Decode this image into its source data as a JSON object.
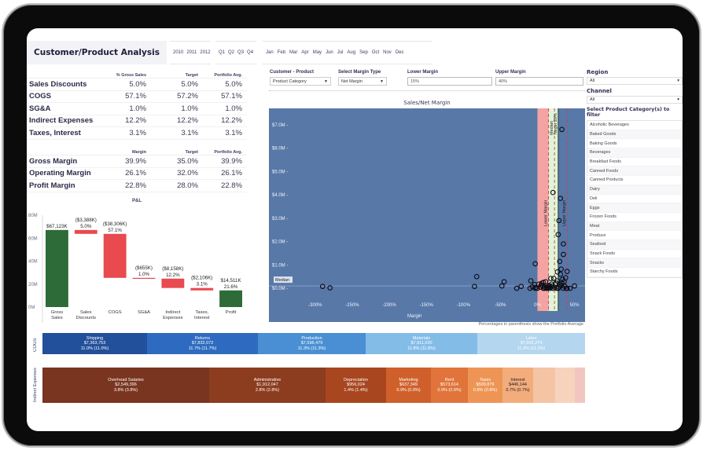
{
  "header": {
    "title": "Customer/Product Analysis",
    "years": [
      "2010",
      "2011",
      "2012"
    ],
    "quarters": [
      "Q1",
      "Q2",
      "Q3",
      "Q4"
    ],
    "months": [
      "Jan",
      "Feb",
      "Mar",
      "Apr",
      "May",
      "Jun",
      "Jul",
      "Aug",
      "Sep",
      "Oct",
      "Nov",
      "Dec"
    ]
  },
  "expenses_table": {
    "headers": [
      "% Gross Sales",
      "Target",
      "Portfolio Avg."
    ],
    "rows": [
      {
        "label": "Sales Discounts",
        "values": [
          "5.0%",
          "5.0%",
          "5.0%"
        ]
      },
      {
        "label": "COGS",
        "values": [
          "57.1%",
          "57.2%",
          "57.1%"
        ]
      },
      {
        "label": "SG&A",
        "values": [
          "1.0%",
          "1.0%",
          "1.0%"
        ]
      },
      {
        "label": "Indirect Expenses",
        "values": [
          "12.2%",
          "12.2%",
          "12.2%"
        ]
      },
      {
        "label": "Taxes, Interest",
        "values": [
          "3.1%",
          "3.1%",
          "3.1%"
        ]
      }
    ]
  },
  "margin_table": {
    "headers": [
      "Margin",
      "Target",
      "Portfolio Avg."
    ],
    "rows": [
      {
        "label": "Gross Margin",
        "values": [
          "39.9%",
          "35.0%",
          "39.9%"
        ]
      },
      {
        "label": "Operating Margin",
        "values": [
          "26.1%",
          "32.0%",
          "26.1%"
        ]
      },
      {
        "label": "Profit Margin",
        "values": [
          "22.8%",
          "28.0%",
          "22.8%"
        ]
      }
    ]
  },
  "controls": {
    "customer_product_label": "Customer - Product",
    "customer_product_value": "Product Category",
    "margin_type_label": "Select Margin Type",
    "margin_type_value": "Net Margin",
    "lower_margin_label": "Lower Margin",
    "lower_margin_value": "15%",
    "upper_margin_label": "Upper Margin",
    "upper_margin_value": "40%"
  },
  "right_panel": {
    "region_label": "Region",
    "region_value": "All",
    "channel_label": "Channel",
    "channel_value": "All",
    "category_label": "Select Product Category(s) to filter",
    "categories": [
      "Alcoholic Beverages",
      "Baked Goods",
      "Baking Goods",
      "Beverages",
      "Breakfast Foods",
      "Canned Foods",
      "Canned Products",
      "Dairy",
      "Deli",
      "Eggs",
      "Frozen Foods",
      "Meat",
      "Produce",
      "Seafood",
      "Snack Foods",
      "Snacks",
      "Starchy Foods"
    ]
  },
  "cogs_treemap": {
    "side_label": "COGS",
    "cells": [
      {
        "name": "Shipping",
        "amount": "$7,363,753",
        "pct": "11.0% (11.0%)",
        "color": "#22509a"
      },
      {
        "name": "Returns",
        "amount": "$7,832,072",
        "pct": "11.7% (11.7%)",
        "color": "#2e6bc0"
      },
      {
        "name": "Production",
        "amount": "$7,596,479",
        "pct": "11.3% (11.3%)",
        "color": "#4a8fd3"
      },
      {
        "name": "Materials",
        "amount": "$7,911,020",
        "pct": "11.8% (11.8%)",
        "color": "#84bce8"
      },
      {
        "name": "Labor",
        "amount": "$7,602,274",
        "pct": "11.3% (11.3%)",
        "color": "#b4d6ef"
      }
    ]
  },
  "indirect_treemap": {
    "side_label": "Indirect Expenses",
    "cells": [
      {
        "name": "Overhead Salaries",
        "amount": "$2,549,396",
        "pct": "3.8% (3.8%)",
        "color": "#7a3520"
      },
      {
        "name": "Administrative",
        "amount": "$1,912,047",
        "pct": "2.8% (2.8%)",
        "color": "#8c3c1f"
      },
      {
        "name": "Depreciation",
        "amount": "$956,024",
        "pct": "1.4% (1.4%)",
        "color": "#a8461f"
      },
      {
        "name": "Marketing",
        "amount": "$637,349",
        "pct": "0.9% (0.9%)",
        "color": "#d0602b"
      },
      {
        "name": "Rent",
        "amount": "$573,614",
        "pct": "0.9% (0.9%)",
        "color": "#e0743a"
      },
      {
        "name": "Taxes",
        "amount": "$509,879",
        "pct": "0.8% (0.8%)",
        "color": "#ee9555"
      },
      {
        "name": "Interest",
        "amount": "$446,144",
        "pct": "0.7% (0.7%)",
        "color": "#f3ad7c"
      },
      {
        "name": "",
        "amount": "",
        "pct": "",
        "color": "#f5c4a4"
      },
      {
        "name": "",
        "amount": "",
        "pct": "",
        "color": "#f7d3bd"
      },
      {
        "name": "",
        "amount": "",
        "pct": "",
        "color": "#f2c6c0"
      }
    ]
  },
  "footnote": "Percentages in parenthesis show the Portfolio Average",
  "chart_data": [
    {
      "type": "bar",
      "title": "P&L",
      "subtype": "waterfall",
      "categories": [
        "Gross Sales",
        "Sales Discounts",
        "COGS",
        "SG&A",
        "Indirect Expenses",
        "Taxes, Interest",
        "Profit"
      ],
      "starts": [
        0,
        63.735,
        25.429,
        24.774,
        16.616,
        14.511,
        0
      ],
      "ends": [
        67.123,
        67.123,
        63.735,
        25.429,
        24.774,
        16.616,
        14.511
      ],
      "labels": [
        "$67,123K",
        "($3,388K)\n5.0%",
        "($38,306K)\n57.1%",
        "($655K)\n1.0%",
        "($8,158K)\n12.2%",
        "($2,106K)\n3.1%",
        "$14,511K\n21.6%"
      ],
      "kind": [
        "total",
        "decrease",
        "decrease",
        "decrease",
        "decrease",
        "decrease",
        "total"
      ],
      "colors": {
        "total": "#2d6b39",
        "decrease": "#e84a4f"
      },
      "yticks": [
        "0M",
        "20M",
        "40M",
        "60M",
        "80M"
      ],
      "ylim": [
        0,
        80
      ],
      "unit": "M"
    },
    {
      "type": "scatter",
      "title": "Sales/Net Margin",
      "xlabel": "Margin",
      "ylabel": "",
      "xlim": [
        -320,
        60
      ],
      "ylim": [
        -0.3,
        7.5
      ],
      "xticks": [
        "-300%",
        "-250%",
        "-200%",
        "-150%",
        "-100%",
        "-50%",
        "0%",
        "50%"
      ],
      "xtick_values": [
        -300,
        -250,
        -200,
        -150,
        -100,
        -50,
        0,
        50
      ],
      "yticks": [
        "$0.0M",
        "$1.0M",
        "$2.0M",
        "$3.0M",
        "$4.0M",
        "$5.0M",
        "$6.0M",
        "$7.0M"
      ],
      "ytick_values": [
        0,
        1,
        2,
        3,
        4,
        5,
        6,
        7
      ],
      "reference_lines": [
        {
          "label": "Median",
          "axis": "y",
          "value": 0.1
        },
        {
          "label": "Lower Margin",
          "axis": "x",
          "value": 15
        },
        {
          "label": "Median",
          "axis": "x",
          "value": 23
        },
        {
          "label": "Target 28%",
          "axis": "x",
          "value": 28
        },
        {
          "label": "Upper Margin",
          "axis": "x",
          "value": 40
        }
      ],
      "bands": [
        {
          "from": 0,
          "to": 15,
          "color": "#f4a3a3"
        },
        {
          "from": 15,
          "to": 28,
          "color": "#dff5d8"
        }
      ],
      "points": [
        [
          -290,
          0.08
        ],
        [
          -280,
          0.02
        ],
        [
          -85,
          0.08
        ],
        [
          -82,
          0.5
        ],
        [
          -48,
          0.1
        ],
        [
          -45,
          0.28
        ],
        [
          -28,
          0.0
        ],
        [
          -22,
          0.08
        ],
        [
          -10,
          0.0
        ],
        [
          -9,
          0.32
        ],
        [
          -7,
          0.06
        ],
        [
          -4,
          0.16
        ],
        [
          -3,
          0.0
        ],
        [
          -2,
          0.03
        ],
        [
          -3,
          1.05
        ],
        [
          0,
          0.0
        ],
        [
          2,
          0.18
        ],
        [
          4,
          0.05
        ],
        [
          5,
          0.15
        ],
        [
          6,
          0.22
        ],
        [
          7,
          0.12
        ],
        [
          8,
          0.25
        ],
        [
          8,
          0.0
        ],
        [
          9,
          0.0
        ],
        [
          10,
          0.05
        ],
        [
          11,
          0.28
        ],
        [
          12,
          0.0
        ],
        [
          13,
          0.05
        ],
        [
          14,
          0.0
        ],
        [
          15,
          0.08
        ],
        [
          16,
          0.12
        ],
        [
          17,
          0.0
        ],
        [
          18,
          0.05
        ],
        [
          18,
          0.42
        ],
        [
          19,
          0.18
        ],
        [
          20,
          0.1
        ],
        [
          21,
          0.0
        ],
        [
          22,
          0.42
        ],
        [
          23,
          0.05
        ],
        [
          24,
          0.15
        ],
        [
          25,
          0.22
        ],
        [
          26,
          0.0
        ],
        [
          27,
          0.32
        ],
        [
          27,
          0.7
        ],
        [
          28,
          0.0
        ],
        [
          29,
          0.05
        ],
        [
          30,
          0.15
        ],
        [
          31,
          0.6
        ],
        [
          32,
          0.12
        ],
        [
          32,
          0.82
        ],
        [
          33,
          0.22
        ],
        [
          34,
          0.38
        ],
        [
          35,
          0.0
        ],
        [
          36,
          0.28
        ],
        [
          37,
          0.08
        ],
        [
          39,
          0.0
        ],
        [
          40,
          0.0
        ],
        [
          40,
          0.72
        ],
        [
          44,
          0.0
        ],
        [
          50,
          0.1
        ],
        [
          30,
          1.15
        ],
        [
          35,
          1.9
        ],
        [
          28,
          2.3
        ],
        [
          21,
          4.1
        ],
        [
          31,
          3.85
        ],
        [
          29,
          2.9
        ],
        [
          33,
          6.8
        ],
        [
          35,
          1.45
        ],
        [
          38,
          0.45
        ]
      ]
    }
  ]
}
